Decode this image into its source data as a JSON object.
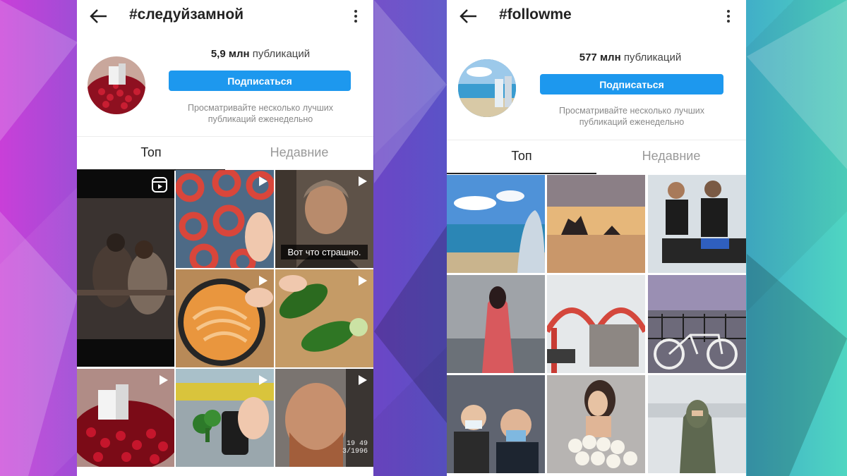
{
  "colors": {
    "accent": "#1d98ee",
    "text": "#222222",
    "muted": "#888888"
  },
  "left": {
    "title": "#следуйзамной",
    "count_number": "5,9 млн",
    "count_label": "публикаций",
    "follow_label": "Подписаться",
    "hint_line1": "Просматривайте несколько лучших",
    "hint_line2": "публикаций еженедельно",
    "tab_top": "Топ",
    "tab_recent": "Недавние",
    "caption": "Вот что страшно.",
    "stamp_time": "19 49",
    "stamp_date": "3/1996"
  },
  "right": {
    "title": "#followme",
    "count_number": "577 млн",
    "count_label": "публикаций",
    "follow_label": "Подписаться",
    "hint_line1": "Просматривайте несколько лучших",
    "hint_line2": "публикаций еженедельно",
    "tab_top": "Топ",
    "tab_recent": "Недавние"
  },
  "icons": [
    "back-arrow-icon",
    "more-vertical-icon",
    "play-icon",
    "reels-icon"
  ]
}
